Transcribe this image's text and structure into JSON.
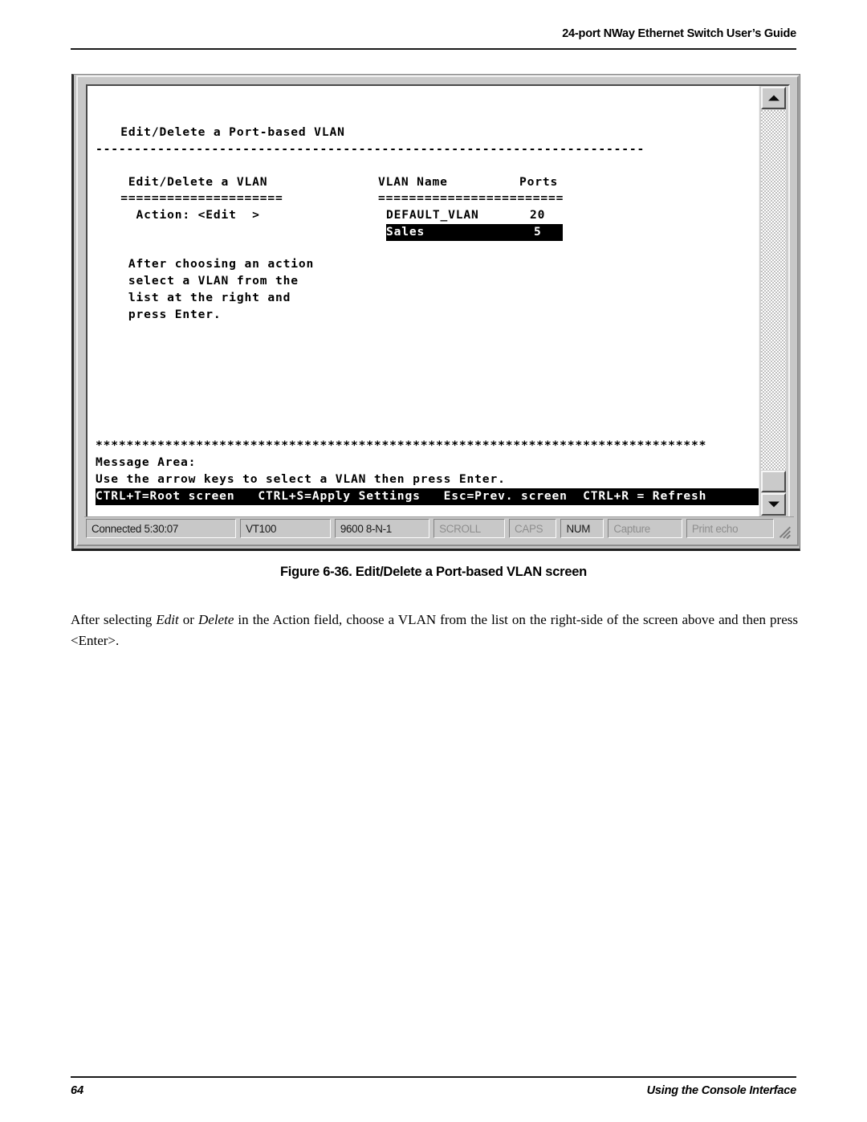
{
  "page": {
    "header_title": "24-port NWay Ethernet Switch User’s Guide",
    "footer_page_number": "64",
    "footer_section": "Using the Console Interface",
    "figure_caption": "Figure 6-36.  Edit/Delete a Port-based VLAN screen"
  },
  "terminal": {
    "title_line": "  Edit/Delete a Port-based VLAN",
    "divider_dashes": "-----------------------------------------------------------------------",
    "left_panel": {
      "heading": "   Edit/Delete a VLAN",
      "rule": "  =====================",
      "action_label": "    Action: <Edit  >",
      "help_lines": [
        "   After choosing an action",
        "   select a VLAN from the",
        "   list at the right and",
        "   press Enter."
      ]
    },
    "right_panel": {
      "header_name": "VLAN Name",
      "header_ports": "Ports",
      "rule": "========================",
      "rows": [
        {
          "name": "DEFAULT_VLAN",
          "ports": "20",
          "selected": false
        },
        {
          "name": "Sales",
          "ports": "5",
          "selected": true
        }
      ]
    },
    "asterisk_rule": "*******************************************************************************",
    "message_area_label": "Message Area:",
    "message_area_text": "Use the arrow keys to select a VLAN then press Enter.",
    "function_key_bar": "CTRL+T=Root screen   CTRL+S=Apply Settings   Esc=Prev. screen  CTRL+R = Refresh"
  },
  "status_bar": {
    "connected": "Connected 5:30:07",
    "emulation": "VT100",
    "line_settings": "9600 8-N-1",
    "scroll": "SCROLL",
    "caps": "CAPS",
    "num": "NUM",
    "capture": "Capture",
    "print_echo": "Print echo"
  },
  "body": {
    "para_part1": "After selecting ",
    "para_em1": "Edit",
    "para_part2": " or ",
    "para_em2": "Delete",
    "para_part3": " in the Action field, choose a VLAN from the list on the right-side of the screen above and then press <Enter>."
  },
  "colors": {
    "ink": "#000000",
    "paper": "#ffffff",
    "chrome": "#c8c8c8",
    "disabled_text": "#8f8f8f"
  }
}
